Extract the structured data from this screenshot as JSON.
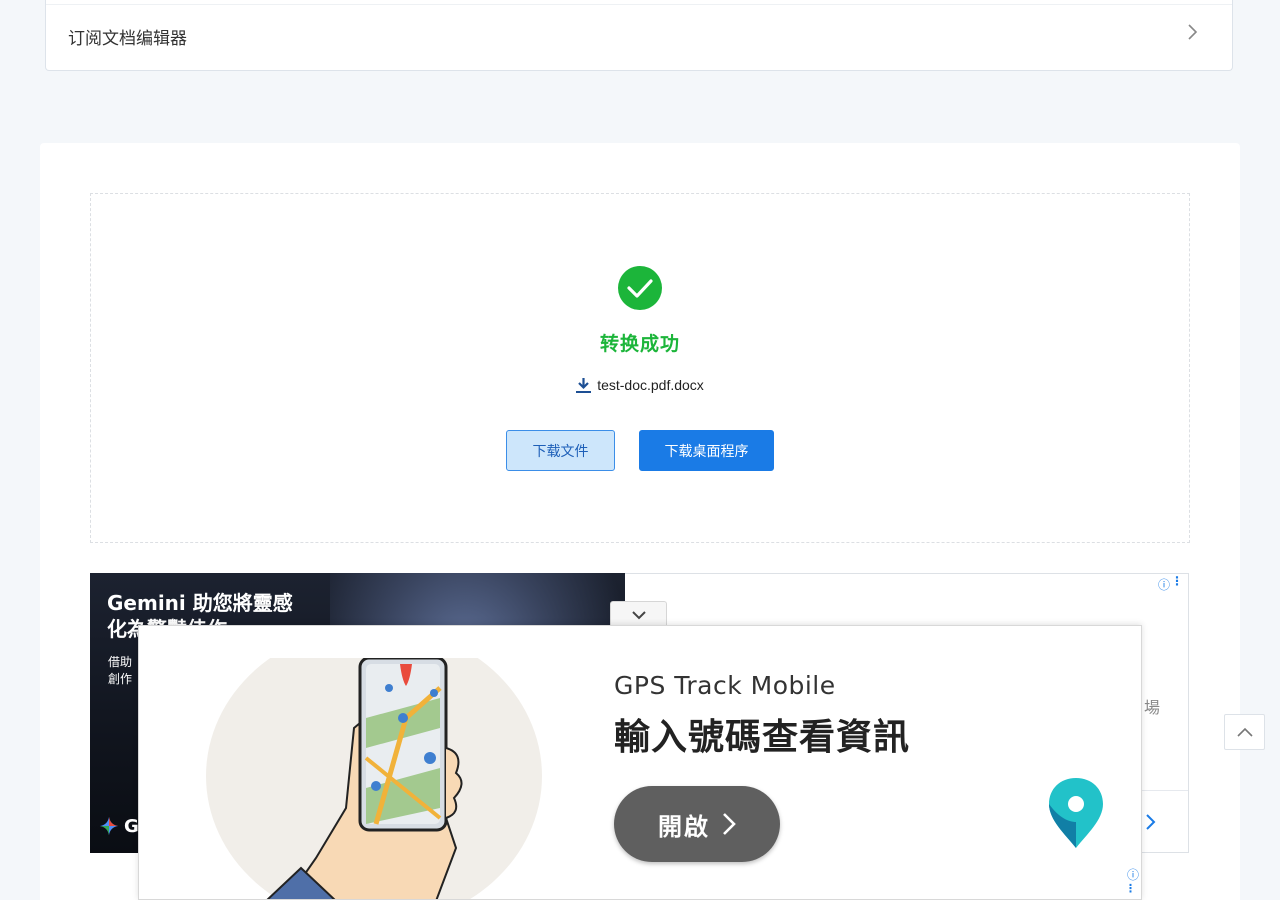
{
  "top_item": {
    "label": "订阅文档编辑器"
  },
  "result": {
    "status_text": "转换成功",
    "file_name": "test-doc.pdf.docx",
    "download_button": "下载文件",
    "desktop_button": "下载桌面程序"
  },
  "ad_gemini": {
    "headline": "Gemini 助您將靈感化為驚豔佳作",
    "subtext": "借助 創作",
    "brand_letter": "G",
    "right_char": "場"
  },
  "anchor_ad": {
    "brand": "GPS Track Mobile",
    "headline": "輸入號碼查看資訊",
    "button": "開啟"
  },
  "colors": {
    "success": "#1cb53a",
    "primary": "#1a7be6",
    "ad_button": "#5f5f5f",
    "pin": "#1fb7c4"
  }
}
